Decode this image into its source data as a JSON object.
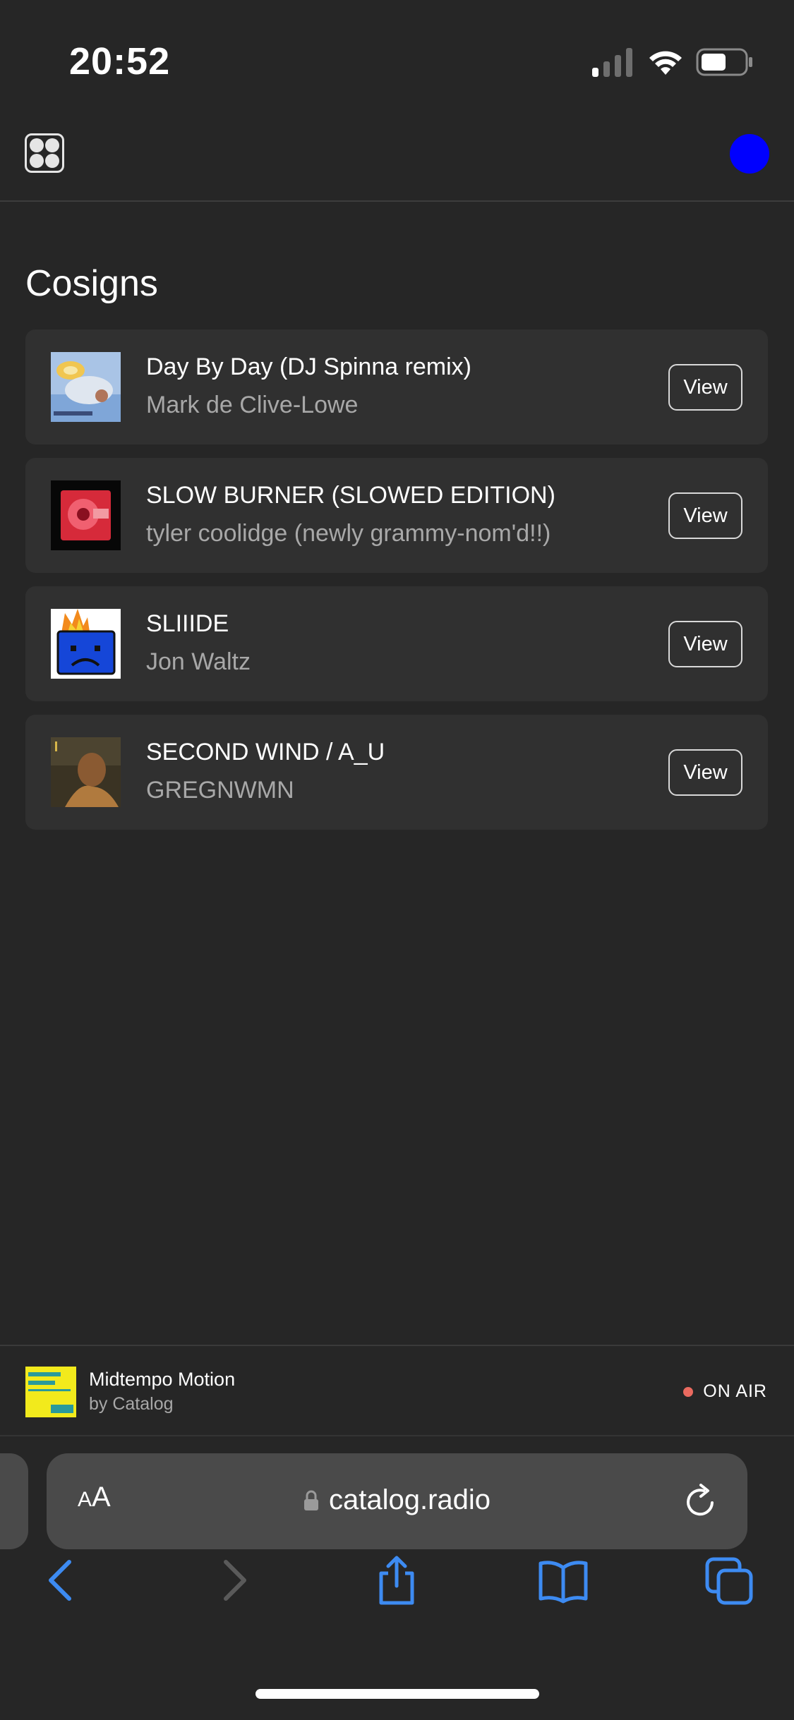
{
  "status_bar": {
    "time": "20:52"
  },
  "header": {
    "logo_icon": "catalog-logo-icon",
    "avatar_color": "#0000ff"
  },
  "section": {
    "title": "Cosigns"
  },
  "cosigns": [
    {
      "title": "Day By Day (DJ Spinna remix)",
      "artist": "Mark de Clive-Lowe",
      "action": "View"
    },
    {
      "title": "SLOW BURNER (SLOWED EDITION)",
      "artist": "tyler coolidge (newly grammy-nom'd!!)",
      "action": "View"
    },
    {
      "title": "SLIIIDE",
      "artist": "Jon Waltz",
      "action": "View"
    },
    {
      "title": "SECOND WIND / A_U",
      "artist": "GREGNWMN",
      "action": "View"
    }
  ],
  "now_playing": {
    "title": "Midtempo Motion",
    "subtitle": "by Catalog",
    "status": "ON AIR",
    "status_color": "#ea6a5f"
  },
  "browser": {
    "aa_label_small": "A",
    "aa_label_large": "A",
    "url": "catalog.radio"
  }
}
